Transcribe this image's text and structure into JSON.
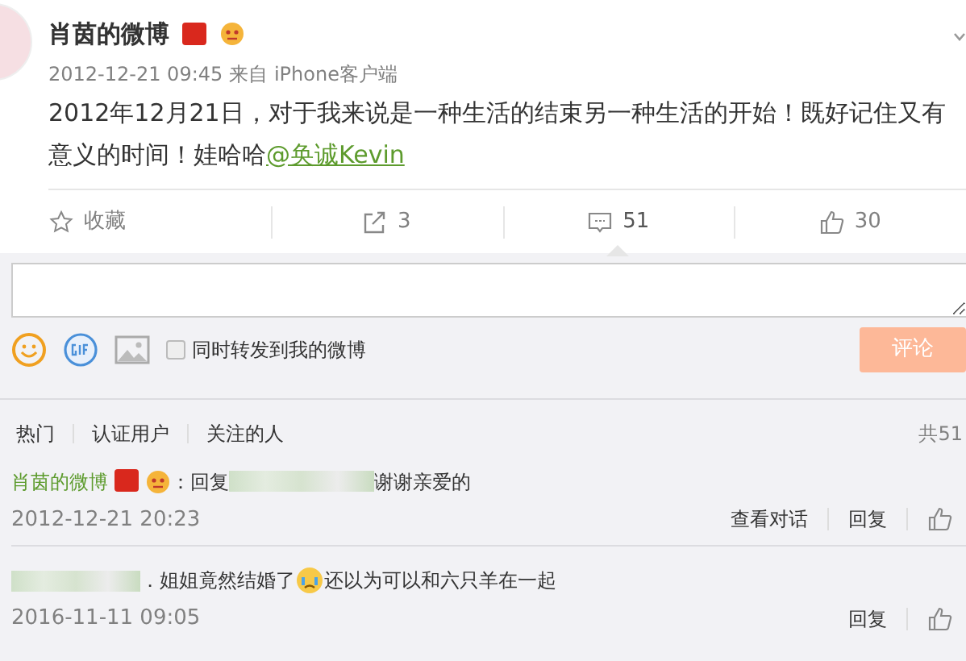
{
  "post": {
    "author": "肖茵的微博",
    "time": "2012-12-21 09:45",
    "source": "来自 iPhone客户端",
    "text": "2012年12月21日，对于我来说是一种生活的结束另一种生活的开始！既好记住又有意义的时间！娃哈哈",
    "mention": "@奂诚Kevin"
  },
  "actions": [
    {
      "kind": "favorite",
      "label": "收藏",
      "selected": false
    },
    {
      "kind": "repost",
      "label": "3",
      "selected": false
    },
    {
      "kind": "comment",
      "label": "51",
      "selected": true
    },
    {
      "kind": "like",
      "label": "30",
      "selected": false
    }
  ],
  "composer": {
    "repost_option": {
      "label": "同时转发到我的微博",
      "checked": false
    },
    "submit": {
      "label": "评论",
      "disabled": true
    }
  },
  "filter_tabs": [
    {
      "label": "热门"
    },
    {
      "label": "认证用户"
    },
    {
      "label": "关注的人"
    }
  ],
  "total": "共51",
  "comments": [
    {
      "segments": [
        {
          "kind": "author",
          "text": "肖茵的微博"
        },
        {
          "kind": "text",
          "text": "：回复"
        },
        {
          "kind": "blurred"
        },
        {
          "kind": "text",
          "text": "谢谢亲爱的"
        }
      ],
      "time": "2012-12-21 20:23",
      "links": [
        "查看对话",
        "回复"
      ]
    },
    {
      "segments": [
        {
          "kind": "blurred"
        },
        {
          "kind": "text",
          "text": "．姐姐竟然结婚了"
        },
        {
          "kind": "emoji"
        },
        {
          "kind": "text",
          "text": "还以为可以和六只羊在一起"
        }
      ],
      "time": "2016-11-11 09:05",
      "links": [
        "回复"
      ]
    }
  ]
}
